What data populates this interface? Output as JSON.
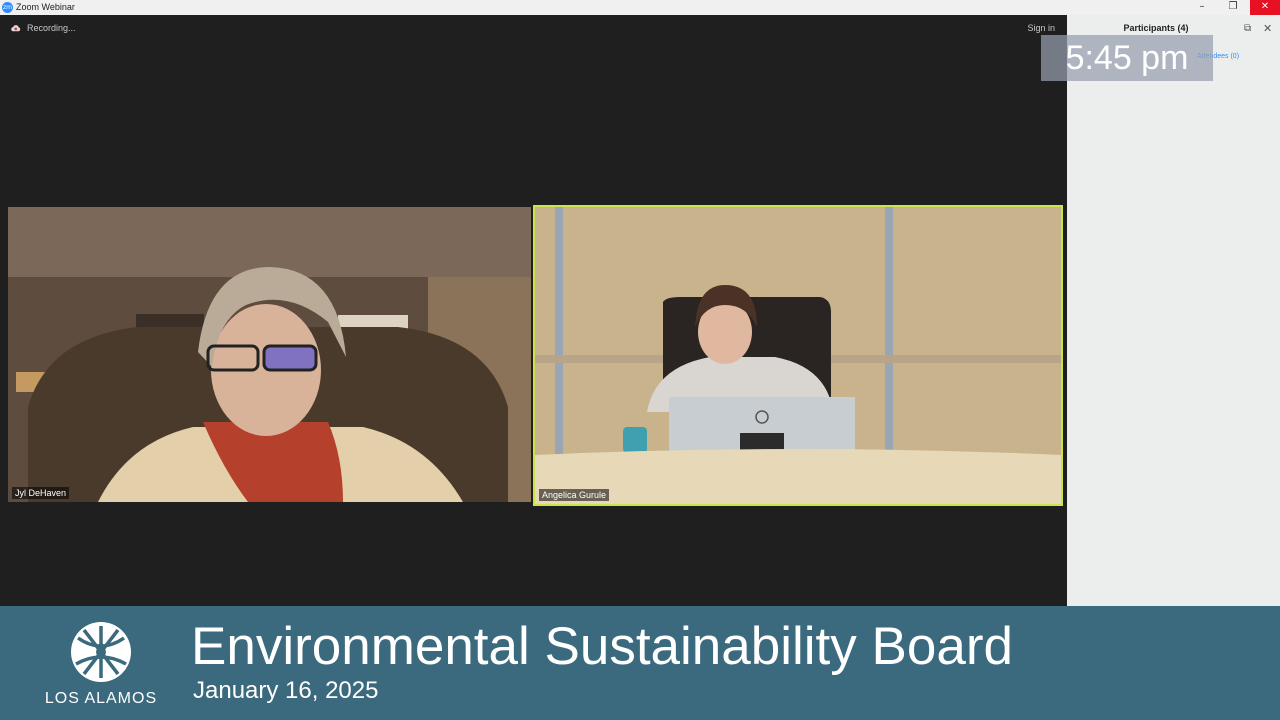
{
  "window": {
    "title": "Zoom Webinar",
    "minimize": "–",
    "restore": "❐",
    "close": "✕",
    "app_icon": "zm"
  },
  "toolbar": {
    "recording_label": "Recording...",
    "signin_label": "Sign in"
  },
  "videos": [
    {
      "name": "Jyl DeHaven"
    },
    {
      "name": "Angelica Gurule"
    }
  ],
  "participants_panel": {
    "title": "Participants (4)",
    "attendees_tab": "Attendees (0)",
    "popout_icon": "⧉",
    "close_icon": "✕"
  },
  "clock": {
    "time": "5:45 pm"
  },
  "banner": {
    "title": "Environmental Sustainability Board",
    "date": "January 16, 2025",
    "org": "LOS ALAMOS",
    "color": "#3b6a7e"
  },
  "colors": {
    "active_speaker_border": "#c8e64a",
    "close_button": "#e81123"
  }
}
